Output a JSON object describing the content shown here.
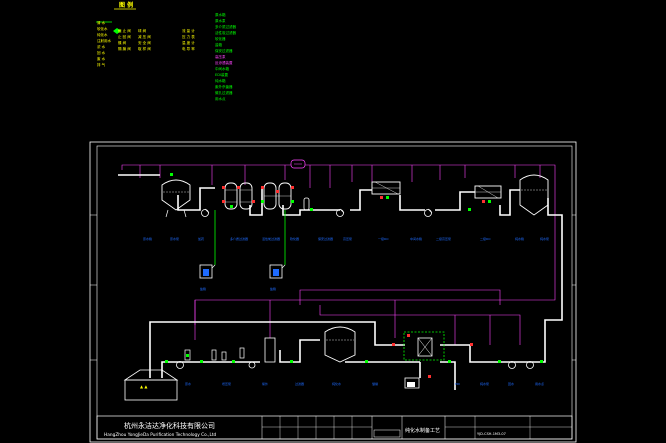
{
  "legend": {
    "title": "图 例",
    "col1": [
      "清 水",
      "软化水",
      "纯化水",
      "注射用水",
      "浓 水",
      "回 水",
      "废 水",
      "排 气"
    ],
    "col2": [
      "截 止 阀",
      "止 回 阀",
      "蝶 阀",
      "隔 膜 阀"
    ],
    "col3": [
      "球 阀",
      "减 压 阀",
      "安 全 阀",
      "取 样 阀"
    ],
    "col4": [
      "流 量 计",
      "压 力 表",
      "温 度 计",
      "电 导 率"
    ],
    "col5": [
      "原水箱",
      "原水泵",
      "多介质过滤器",
      "活性炭过滤器",
      "软化器",
      "盐箱",
      "保安过滤器",
      "高压泵",
      "反渗透装置",
      "中间水箱",
      "EDI装置",
      "纯水箱",
      "紫外杀菌器",
      "微孔过滤器",
      "用水点"
    ]
  },
  "colors": {
    "frame": "#ffffff",
    "label_yellow": "#ffff00",
    "label_green": "#00ff00",
    "signal": "#ff44ff",
    "equipment_blue": "#1e6bff",
    "pipe": "#ffffff",
    "valve_green": "#00ff00",
    "valve_red": "#ff3030"
  },
  "title_block": {
    "company_cn": "杭州永洁达净化科技有限公司",
    "company_en": "HangZhou YongJieDa Purification Technology Co.,Ltd",
    "drawing_title": "纯化水制备工艺",
    "drawing_no": "YJD-CSH-1M3-07",
    "sheet": "",
    "revision": ""
  },
  "tags": {
    "row1": [
      "原水箱",
      "原水泵",
      "加药",
      "多介质过滤器",
      "活性炭过滤器",
      "软化器",
      "保安过滤器",
      "高压泵",
      "一级RO",
      "中间水箱",
      "二级高压泵",
      "二级RO",
      "纯水箱",
      "纯水泵"
    ],
    "salt_tanks": [
      "盐箱",
      "盐箱"
    ],
    "row2": [
      "原水",
      "增压泵",
      "紫外",
      "过滤器",
      "纯化水",
      "储罐",
      "EDI",
      "纯水泵",
      "回水",
      "用水点"
    ]
  }
}
